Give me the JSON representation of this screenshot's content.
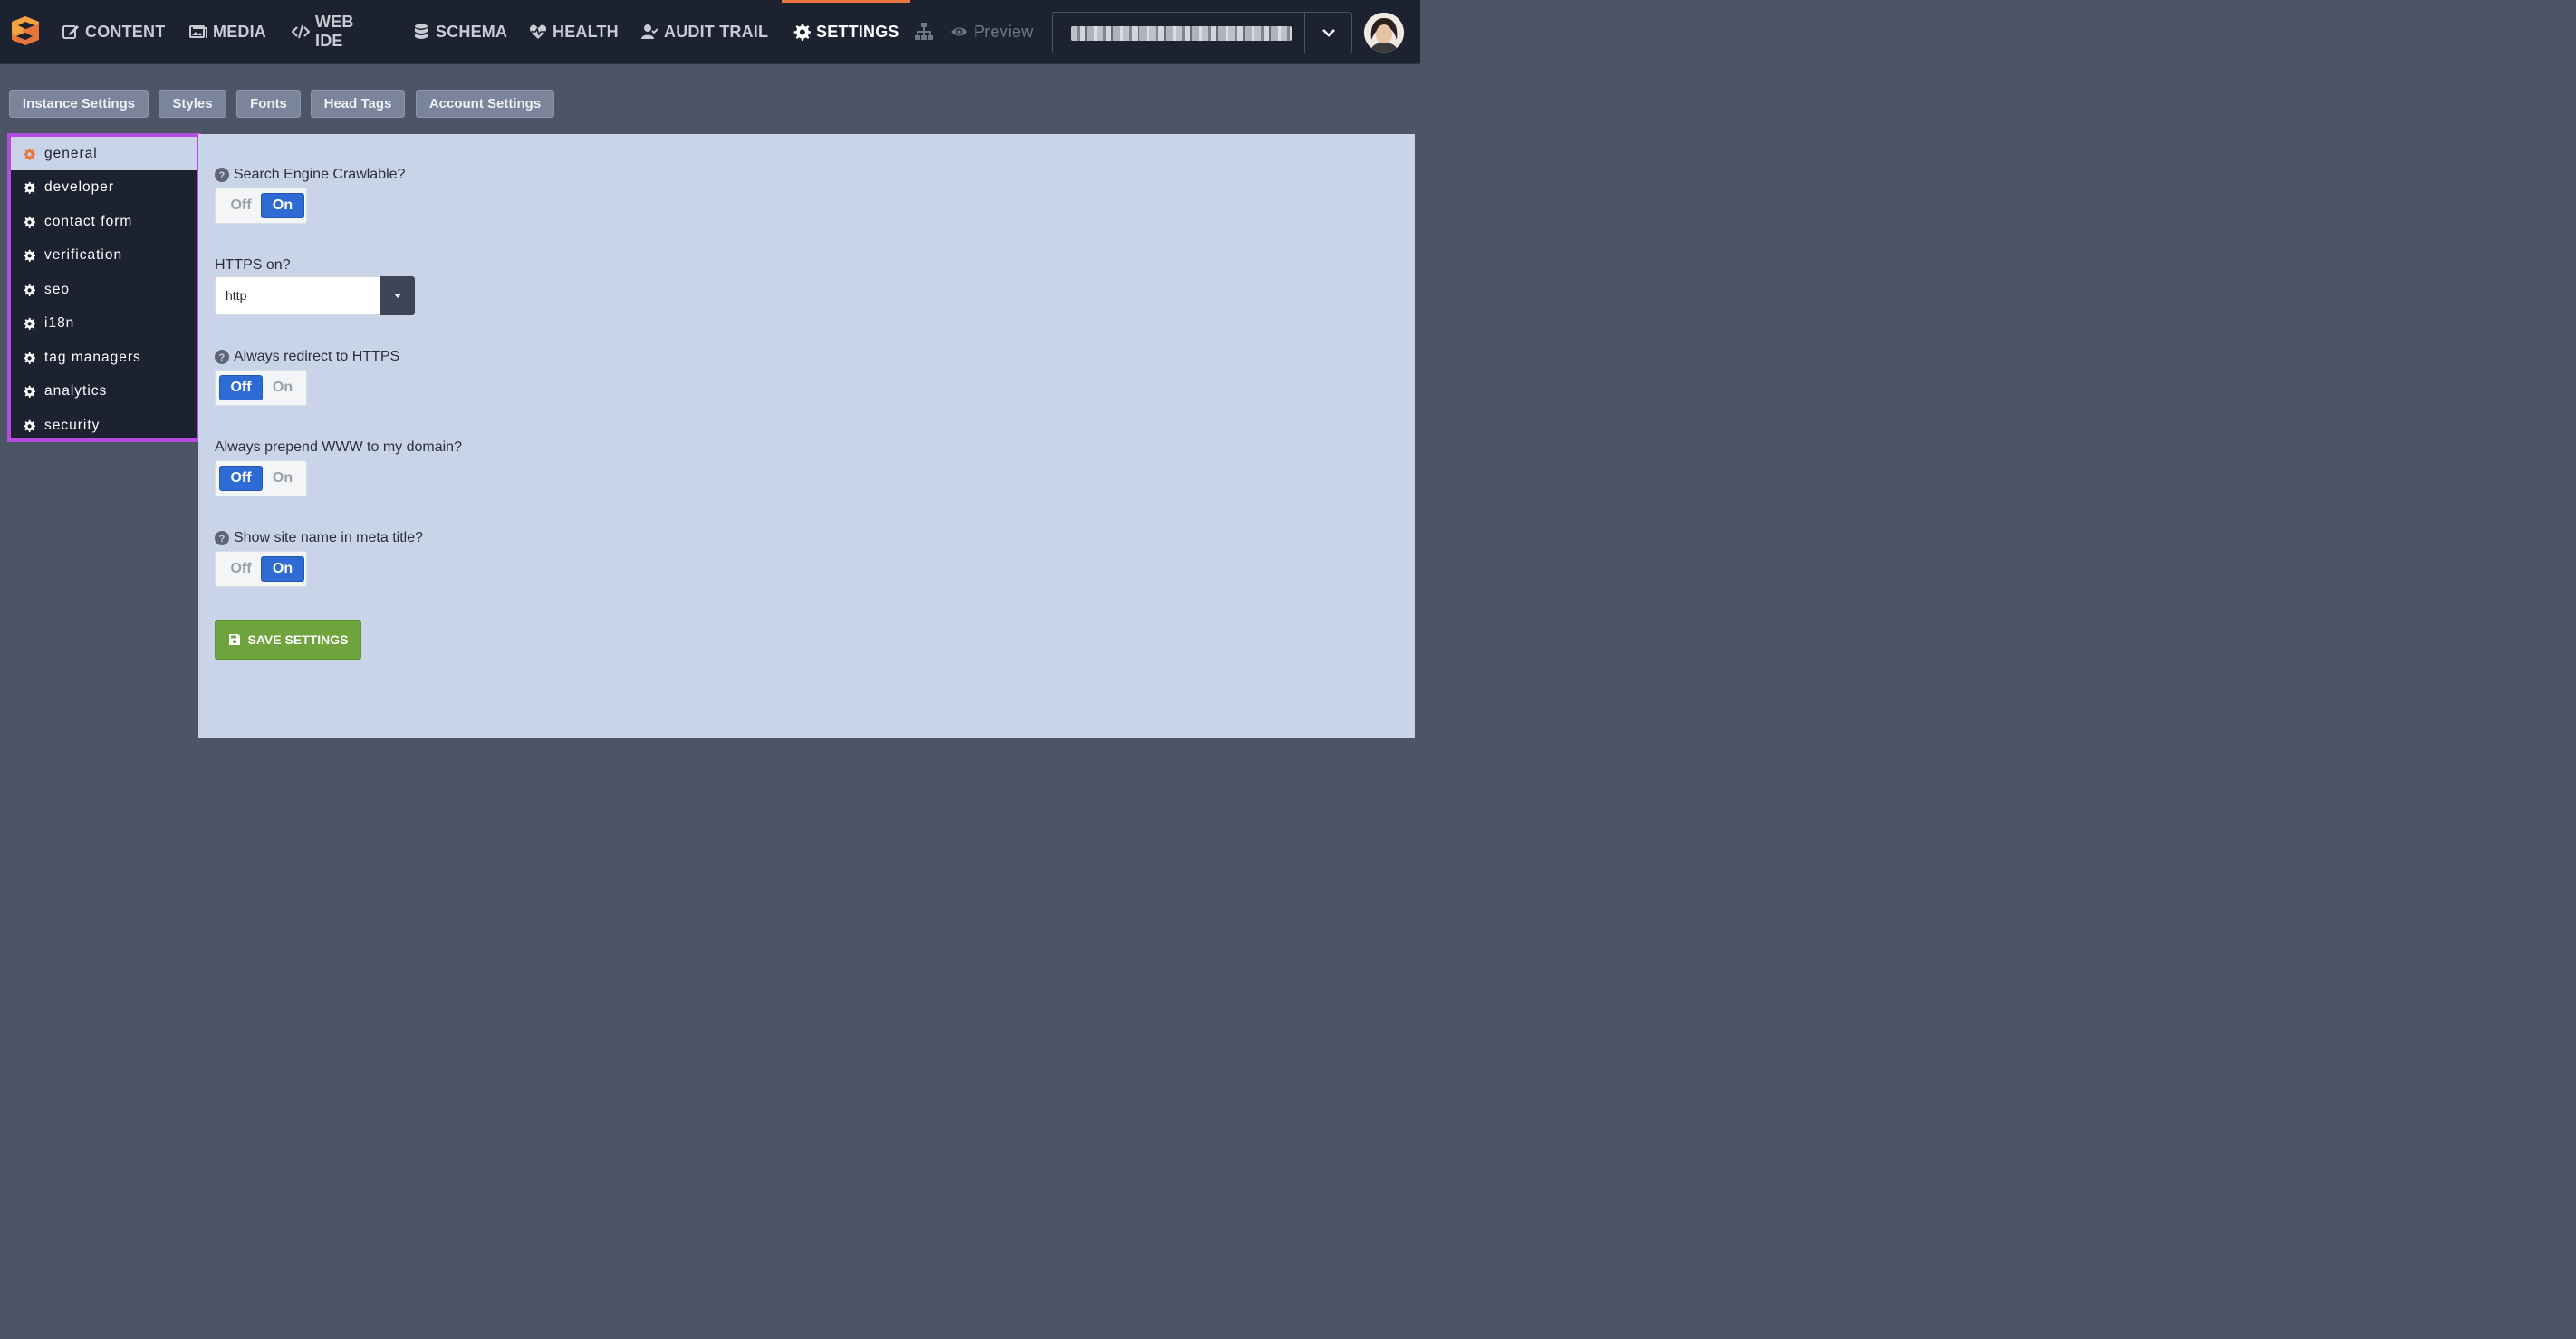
{
  "nav": {
    "items": [
      {
        "label": "CONTENT",
        "icon": "edit-icon"
      },
      {
        "label": "MEDIA",
        "icon": "images-icon"
      },
      {
        "label": "WEB\nIDE",
        "icon": "code-icon"
      },
      {
        "label": "SCHEMA",
        "icon": "database-icon"
      },
      {
        "label": "HEALTH",
        "icon": "heartbeat-icon"
      },
      {
        "label": "AUDIT TRAIL",
        "icon": "user-check-icon"
      },
      {
        "label": "SETTINGS",
        "icon": "gear-icon"
      }
    ],
    "active": "SETTINGS",
    "preview_label": "Preview",
    "accent_color": "#e8763a"
  },
  "tabs": [
    "Instance Settings",
    "Styles",
    "Fonts",
    "Head Tags",
    "Account Settings"
  ],
  "sidebar": {
    "items": [
      "general",
      "developer",
      "contact form",
      "verification",
      "seo",
      "i18n",
      "tag managers",
      "analytics",
      "security"
    ],
    "active": "general",
    "highlight_color": "#b24de0"
  },
  "settings": {
    "crawlable": {
      "label": "Search Engine Crawlable?",
      "off": "Off",
      "on": "On",
      "value": "On"
    },
    "https": {
      "label": "HTTPS on?",
      "value": "http"
    },
    "redirect_https": {
      "label": "Always redirect to HTTPS",
      "off": "Off",
      "on": "On",
      "value": "Off"
    },
    "prepend_www": {
      "label": "Always prepend WWW to my domain?",
      "off": "Off",
      "on": "On",
      "value": "Off"
    },
    "site_name_meta": {
      "label": "Show site name in meta title?",
      "off": "Off",
      "on": "On",
      "value": "On"
    }
  },
  "save_label": "SAVE SETTINGS",
  "toggle_color": "#2f6bd5",
  "save_color": "#6ea43b"
}
